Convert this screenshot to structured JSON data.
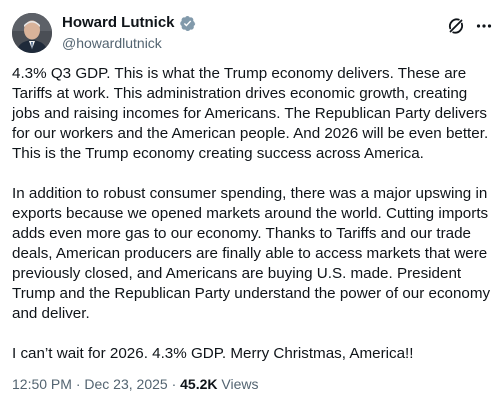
{
  "author": {
    "display_name": "Howard Lutnick",
    "handle": "@howardlutnick",
    "verified_color": "#829aab"
  },
  "tweet": {
    "paragraphs": [
      "4.3% Q3 GDP. This is what the Trump economy delivers. These are Tariffs at work. This administration drives economic growth, creating jobs and raising incomes for Americans. The Republican Party delivers for our workers and the American people. And 2026 will be even better. This is the Trump economy creating success across America.",
      "In addition to robust consumer spending, there was a major upswing in exports because we opened markets around the world. Cutting imports adds even more gas to our economy. Thanks to Tariffs and our trade deals, American producers are finally able to access markets that were previously closed, and Americans are buying U.S. made. President Trump and the Republican Party understand the power of our economy and deliver.",
      "I can’t wait for 2026. 4.3% GDP. Merry Christmas, America!!"
    ]
  },
  "meta": {
    "time": "12:50 PM",
    "separator": " · ",
    "date": "Dec 23, 2025",
    "views_count": "45.2K",
    "views_label": " Views"
  },
  "icons": {
    "avatar": "avatar-photo",
    "verified": "verified-badge-icon",
    "grok": "grok-icon",
    "more": "more-options-icon"
  },
  "colors": {
    "text_primary": "#0f1419",
    "text_secondary": "#536471",
    "verified_badge": "#829aab"
  }
}
